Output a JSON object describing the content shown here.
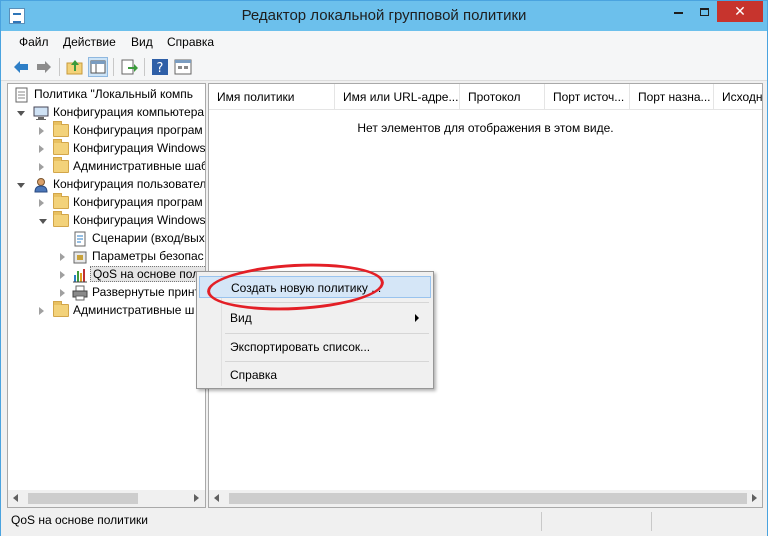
{
  "window": {
    "title": "Редактор локальной групповой политики"
  },
  "title_buttons": {
    "minimize": "minimize",
    "maximize": "maximize",
    "close": "✕"
  },
  "menu": [
    "Файл",
    "Действие",
    "Вид",
    "Справка"
  ],
  "toolbar": {
    "icons": [
      "back-icon",
      "forward-icon",
      "up-folder-icon",
      "show-hide-tree-icon",
      "export-list-icon",
      "help-icon",
      "properties-icon"
    ]
  },
  "tree": {
    "items": [
      {
        "label": "Политика \"Локальный компь",
        "icon": "policy-icon"
      },
      {
        "label": "Конфигурация компьютера",
        "icon": "computer-icon"
      },
      {
        "label": "Конфигурация програм",
        "icon": "folder-icon"
      },
      {
        "label": "Конфигурация Windows",
        "icon": "folder-icon"
      },
      {
        "label": "Административные шаб",
        "icon": "folder-icon"
      },
      {
        "label": "Конфигурация пользовател",
        "icon": "user-icon"
      },
      {
        "label": "Конфигурация програм",
        "icon": "folder-icon"
      },
      {
        "label": "Конфигурация Windows",
        "icon": "folder-icon"
      },
      {
        "label": "Сценарии (вход/вых",
        "icon": "script-icon"
      },
      {
        "label": "Параметры безопас",
        "icon": "security-icon"
      },
      {
        "label": "QoS на основе поли",
        "icon": "qos-chart-icon"
      },
      {
        "label": "Развернутые принт",
        "icon": "printer-icon"
      },
      {
        "label": "Административные ш",
        "icon": "folder-icon"
      }
    ]
  },
  "list": {
    "columns": [
      "Имя политики",
      "Имя или URL-адре...",
      "Протокол",
      "Порт источ...",
      "Порт назна...",
      "Исходн"
    ],
    "empty_message": "Нет элементов для отображения в этом виде."
  },
  "context_menu": {
    "items": [
      {
        "label": "Создать новую политику ...",
        "highlighted": true
      },
      {
        "label": "Вид",
        "submenu": true
      },
      {
        "label": "Экспортировать список..."
      },
      {
        "label": "Справка"
      }
    ]
  },
  "status": {
    "text": "QoS на основе политики"
  },
  "colors": {
    "titlebar": "#6cc0ec",
    "close_button": "#c7342d",
    "annotation": "#e31f26",
    "selection": "#d5e6f7"
  }
}
